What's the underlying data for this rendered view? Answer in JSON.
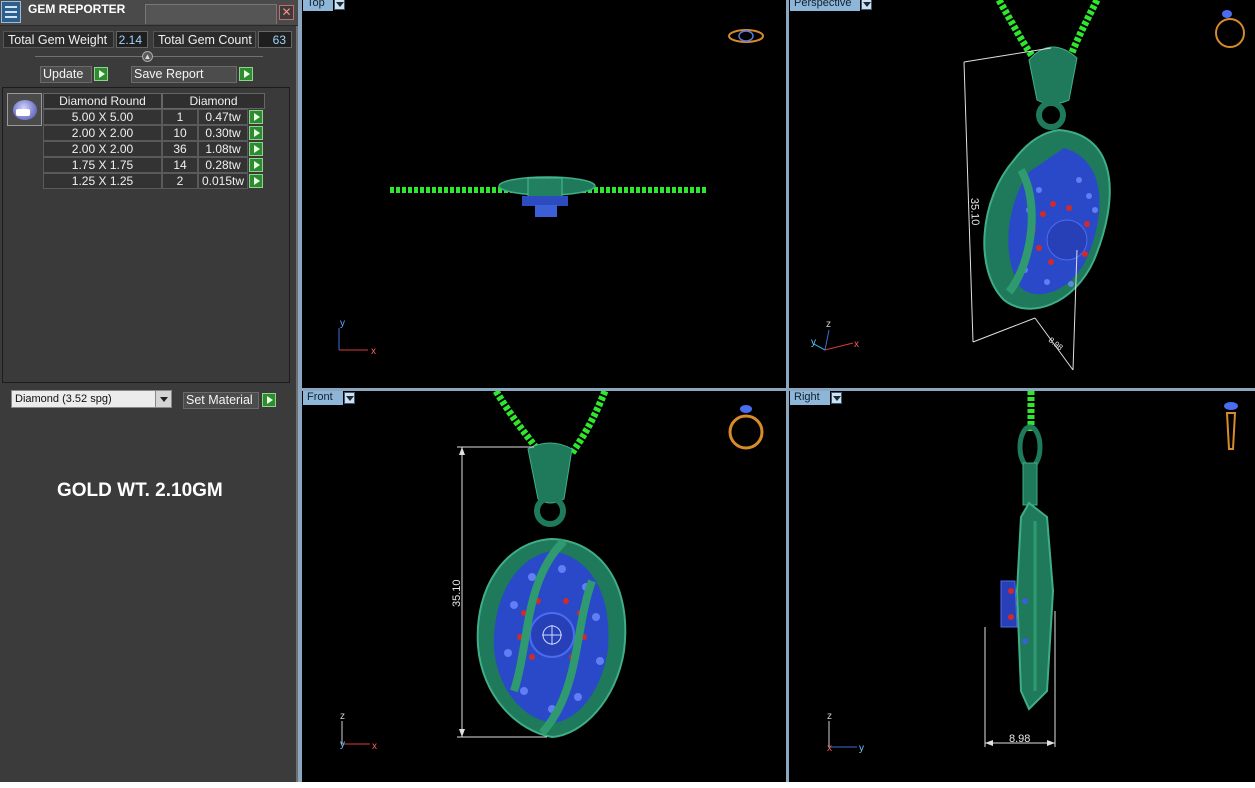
{
  "panel": {
    "title": "GEM REPORTER",
    "close_glyph": "✕",
    "total_gem_weight_label": "Total Gem Weight",
    "total_gem_weight_value": "2.14",
    "total_gem_count_label": "Total Gem Count",
    "total_gem_count_value": "63",
    "update_label": "Update",
    "save_report_label": "Save Report",
    "table": {
      "headers": [
        "Diamond Round",
        "Diamond"
      ],
      "rows": [
        {
          "size": "5.00 X 5.00",
          "count": "1",
          "weight": "0.47tw"
        },
        {
          "size": "2.00 X 2.00",
          "count": "10",
          "weight": "0.30tw"
        },
        {
          "size": "2.00 X 2.00",
          "count": "36",
          "weight": "1.08tw"
        },
        {
          "size": "1.75 X 1.75",
          "count": "14",
          "weight": "0.28tw"
        },
        {
          "size": "1.25 X 1.25",
          "count": "2",
          "weight": "0.015tw"
        }
      ]
    },
    "material_select": "Diamond    (3.52 spg)",
    "set_material_label": "Set Material",
    "gold_weight_text": "GOLD WT. 2.10GM"
  },
  "viewports": {
    "top": {
      "label": "Top"
    },
    "perspective": {
      "label": "Perspective",
      "dimension_height": "35.10",
      "dimension_depth": "8.98"
    },
    "front": {
      "label": "Front",
      "dimension_height": "35.10"
    },
    "right": {
      "label": "Right",
      "dimension_width": "8.98"
    }
  },
  "axes": {
    "x": "x",
    "y": "y",
    "z": "z"
  },
  "colors": {
    "metal": "#1e7a5a",
    "chain": "#2ee82e",
    "stones": "#3b5fd6",
    "accent_stones": "#d02a2a",
    "viewport_tab": "#8eb6d8",
    "panel_bg": "#3b3b3b"
  }
}
